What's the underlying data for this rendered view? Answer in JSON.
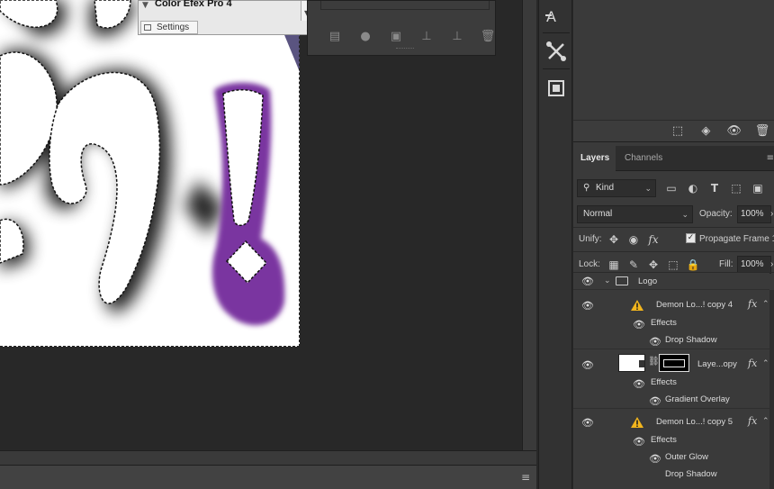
{
  "color_efex": {
    "title": "Color Efex Pro 4",
    "settings_tab": "Settings"
  },
  "right_panel": {
    "tabs": [
      "Layers",
      "Channels"
    ],
    "kind_filter": "Kind",
    "blend_mode": "Normal",
    "opacity_label": "Opacity:",
    "opacity_value": "100%",
    "unify_label": "Unify:",
    "propagate_label": "Propagate Frame 1",
    "propagate_checked": true,
    "lock_label": "Lock:",
    "fill_label": "Fill:",
    "fill_value": "100%"
  },
  "layers": {
    "group_name": "Logo",
    "layer1": {
      "name": "Demon Lo...! copy 4",
      "effects_label": "Effects",
      "effect1": "Drop Shadow"
    },
    "layer2": {
      "name": "Laye...opy",
      "effects_label": "Effects",
      "effect1": "Gradient Overlay"
    },
    "layer3": {
      "name": "Demon Lo...! copy 5",
      "effects_label": "Effects",
      "effect1": "Outer Glow",
      "effect2": "Drop Shadow"
    }
  },
  "icons": {
    "fx": "fx",
    "status_menu": "≡"
  },
  "colors": {
    "purple_spray": "#7a35a0",
    "panel_bg": "#3a3a3a",
    "canvas_bg": "#282828",
    "warning": "#f2b51d"
  }
}
